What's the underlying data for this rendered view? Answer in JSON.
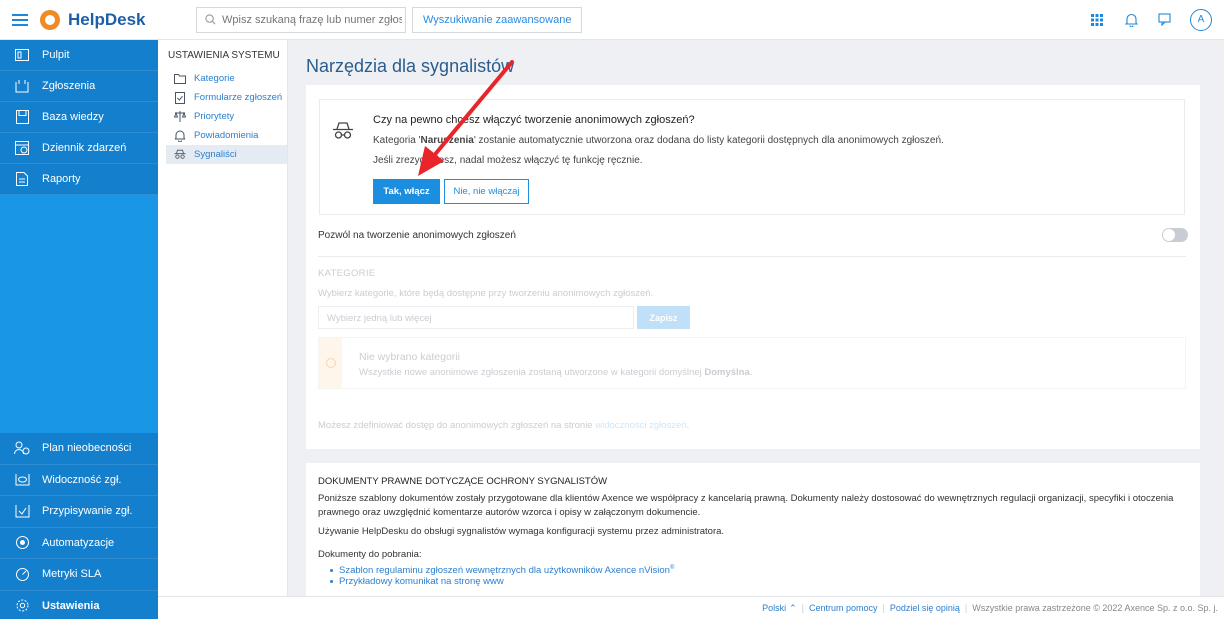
{
  "topbar": {
    "app_name": "HelpDesk",
    "search_placeholder": "Wpisz szukaną frazę lub numer zgłoszenia",
    "advanced_search": "Wyszukiwanie zaawansowane",
    "avatar_letter": "A",
    "icons": [
      "menu-icon",
      "apps-grid-icon",
      "bell-icon",
      "chat-icon"
    ]
  },
  "nav": {
    "top_items": [
      {
        "label": "Pulpit",
        "icon": "dashboard-icon"
      },
      {
        "label": "Zgłoszenia",
        "icon": "tickets-icon"
      },
      {
        "label": "Baza wiedzy",
        "icon": "knowledge-base-icon"
      },
      {
        "label": "Dziennik zdarzeń",
        "icon": "event-log-icon"
      },
      {
        "label": "Raporty",
        "icon": "reports-icon"
      }
    ],
    "bottom_items": [
      {
        "label": "Plan nieobecności",
        "icon": "absence-plan-icon"
      },
      {
        "label": "Widoczność zgł.",
        "icon": "visibility-icon"
      },
      {
        "label": "Przypisywanie zgł.",
        "icon": "assignment-icon"
      },
      {
        "label": "Automatyzacje",
        "icon": "automation-icon"
      },
      {
        "label": "Metryki SLA",
        "icon": "sla-icon"
      },
      {
        "label": "Ustawienia",
        "icon": "settings-icon"
      }
    ]
  },
  "subnav": {
    "title": "USTAWIENIA SYSTEMU",
    "items": [
      {
        "label": "Kategorie",
        "icon": "folder-icon"
      },
      {
        "label": "Formularze zgłoszeń",
        "icon": "form-icon"
      },
      {
        "label": "Priorytety",
        "icon": "scales-icon"
      },
      {
        "label": "Powiadomienia",
        "icon": "bell-icon"
      },
      {
        "label": "Sygnaliści",
        "icon": "incognito-icon"
      }
    ]
  },
  "main": {
    "title": "Narzędzia dla sygnalistów",
    "confirm": {
      "question": "Czy na pewno chcesz włączyć tworzenie anonimowych zgłoszeń?",
      "line2_prefix": "Kategoria '",
      "line2_bold": "Naruszenia",
      "line2_suffix": "' zostanie automatycznie utworzona oraz dodana do listy kategorii dostępnych dla anonimowych zgłoszeń.",
      "line3": "Jeśli zrezygnujesz, nadal możesz włączyć tę funkcję ręcznie.",
      "yes_button": "Tak, włącz",
      "no_button": "Nie, nie włączaj"
    },
    "allow_label": "Pozwól na tworzenie anonimowych zgłoszeń",
    "allow_toggle_on": false,
    "categories": {
      "title": "KATEGORIE",
      "description": "Wybierz kategorie, które będą dostępne przy tworzeniu anonimowych zgłoszeń.",
      "select_placeholder": "Wybierz jedną lub więcej",
      "save_button": "Zapisz",
      "warning_title": "Nie wybrano kategorii",
      "warning_text_prefix": "Wszystkie nowe anonimowe zgłoszenia zostaną utworzone w kategorii domyślnej ",
      "warning_text_bold": "Domyślna",
      "warning_text_suffix": "."
    },
    "access": {
      "text": "Możesz zdefiniować dostęp do anonimowych zgłoszeń na stronie ",
      "link": "widoczności zgłoszeń",
      "suffix": "."
    },
    "docs": {
      "title": "DOKUMENTY PRAWNE DOTYCZĄCE OCHRONY SYGNALISTÓW",
      "p1": "Poniższe szablony dokumentów zostały przygotowane dla klientów Axence we współpracy z kancelarią prawną. Dokumenty należy dostosować do wewnętrznych regulacji organizacji, specyfiki i otoczenia prawnego oraz uwzględnić komentarze autorów wzorca i opisy w załączonym dokumencie.",
      "p2": "Używanie HelpDesku do obsługi sygnalistów wymaga konfiguracji systemu przez administratora.",
      "p3": "Dokumenty do pobrania:",
      "link1": "Szablon regulaminu zgłoszeń wewnętrznych dla użytkowników Axence nVision",
      "link1_sup": "®",
      "link2": "Przykładowy komunikat na stronę www"
    }
  },
  "footer": {
    "language": "Polski",
    "help": "Centrum pomocy",
    "feedback": "Podziel się opinią",
    "copyright": "Wszystkie prawa zastrzeżone © 2022 Axence Sp. z o.o. Sp. j."
  },
  "colors": {
    "nav_blue": "#1a96e6",
    "nav_active": "#0c5fa6",
    "primary_button": "#1c8ee0",
    "arrow": "#e8252a",
    "logo_orange": "#f08a24"
  }
}
